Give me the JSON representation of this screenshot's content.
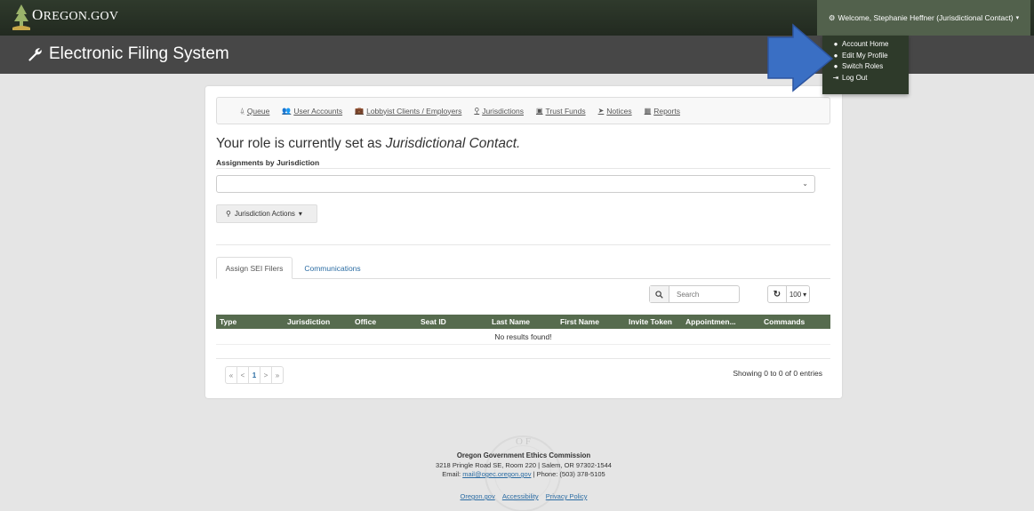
{
  "header": {
    "logo_text_first": "O",
    "logo_text_rest": "REGON.GOV",
    "welcome": "Welcome, Stephanie Heffner (Jurisdictional Contact)"
  },
  "brand": {
    "title": "Electronic Filing System"
  },
  "user_menu": {
    "items": [
      {
        "label": "Account Home",
        "icon": "user-icon"
      },
      {
        "label": "Edit My Profile",
        "icon": "user-icon"
      },
      {
        "label": "Switch Roles",
        "icon": "users-icon"
      },
      {
        "label": "Log Out",
        "icon": "sign-out-icon"
      }
    ]
  },
  "nav": {
    "items": [
      {
        "label": "Queue",
        "icon": "inbox-icon"
      },
      {
        "label": "User Accounts",
        "icon": "users-icon"
      },
      {
        "label": "Lobbyist Clients / Employers",
        "icon": "briefcase-icon"
      },
      {
        "label": "Jurisdictions",
        "icon": "person-pin-icon"
      },
      {
        "label": "Trust Funds",
        "icon": "money-icon"
      },
      {
        "label": "Notices",
        "icon": "send-icon"
      },
      {
        "label": "Reports",
        "icon": "table-icon"
      }
    ]
  },
  "main": {
    "role_prefix": "Your role is currently set as ",
    "role_name": "Jurisdictional Contact.",
    "assign_label": "Assignments by Jurisdiction",
    "jurisdiction_select_value": "",
    "actions_label": "Jurisdiction Actions"
  },
  "tabs": [
    {
      "label": "Assign SEI Filers",
      "active": true
    },
    {
      "label": "Communications",
      "active": false
    }
  ],
  "table": {
    "search_placeholder": "Search",
    "page_size": "100",
    "columns": [
      "Type",
      "Jurisdiction",
      "Office",
      "Seat ID",
      "Last Name",
      "First Name",
      "Invite Token",
      "Appointmen...",
      "Commands"
    ],
    "empty_text": "No results found!",
    "pager": [
      "«",
      "<",
      "1",
      ">",
      "»"
    ],
    "current_page": "1",
    "showing": "Showing 0 to 0 of 0 entries"
  },
  "footer": {
    "seal_text": "OF",
    "org": "Oregon Government Ethics Commission",
    "address": "3218 Pringle Road SE, Room 220 | Salem, OR 97302-1544",
    "email_prefix": "Email: ",
    "email": "mail@ogec.oregon.gov",
    "phone": " | Phone: (503) 378-5105",
    "links": [
      "Oregon.gov",
      "Accessibility",
      "Privacy Policy"
    ]
  },
  "colors": {
    "topbar": "#2f3a2c",
    "welcome_bg": "#52614c",
    "brandband": "#474747",
    "table_header": "#566b4e",
    "arrow": "#3a6fc4",
    "link": "#2b6ca3"
  }
}
